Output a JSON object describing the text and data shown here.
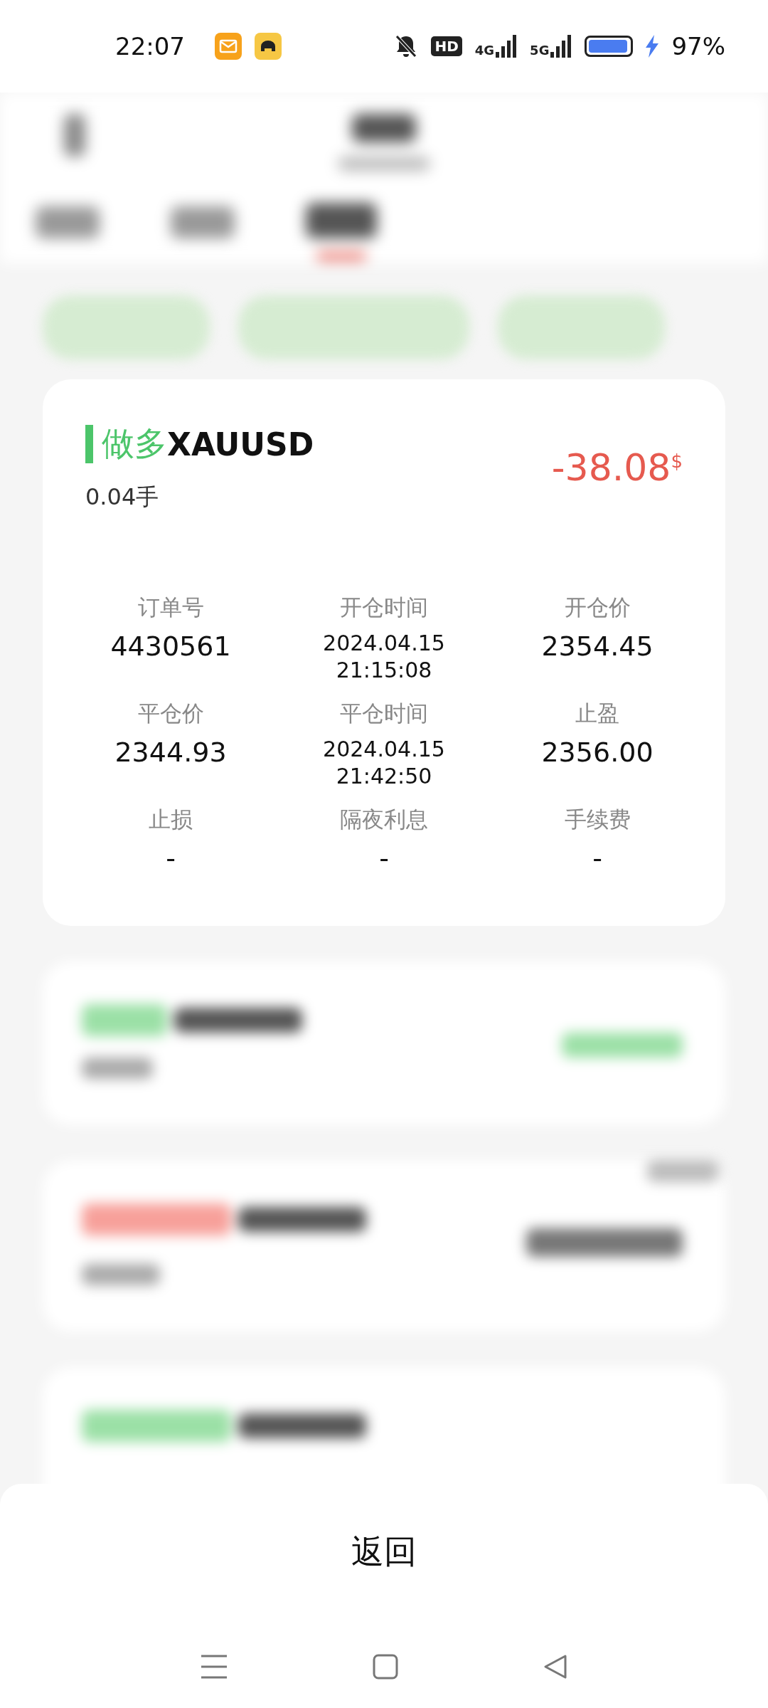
{
  "status_bar": {
    "time": "22:07",
    "hd_badge": "HD",
    "networks": [
      "4G",
      "5G"
    ],
    "battery": "97%"
  },
  "order": {
    "side": {
      "label": "做多",
      "kind": "long"
    },
    "symbol": "XAUUSD",
    "volume": "0.04手",
    "profit": {
      "value": "-38.08",
      "unit": "$",
      "kind": "loss"
    },
    "fields": [
      {
        "label": "订单号",
        "lines": [
          "4430561"
        ]
      },
      {
        "label": "开仓时间",
        "lines": [
          "2024.04.15",
          "21:15:08"
        ]
      },
      {
        "label": "开仓价",
        "lines": [
          "2354.45"
        ]
      },
      {
        "label": "平仓价",
        "lines": [
          "2344.93"
        ]
      },
      {
        "label": "平仓时间",
        "lines": [
          "2024.04.15",
          "21:42:50"
        ]
      },
      {
        "label": "止盈",
        "lines": [
          "2356.00"
        ]
      },
      {
        "label": "止损",
        "lines": [
          "-"
        ]
      },
      {
        "label": "隔夜利息",
        "lines": [
          "-"
        ]
      },
      {
        "label": "手续费",
        "lines": [
          "-"
        ]
      }
    ]
  },
  "sheet": {
    "button": "返回"
  }
}
